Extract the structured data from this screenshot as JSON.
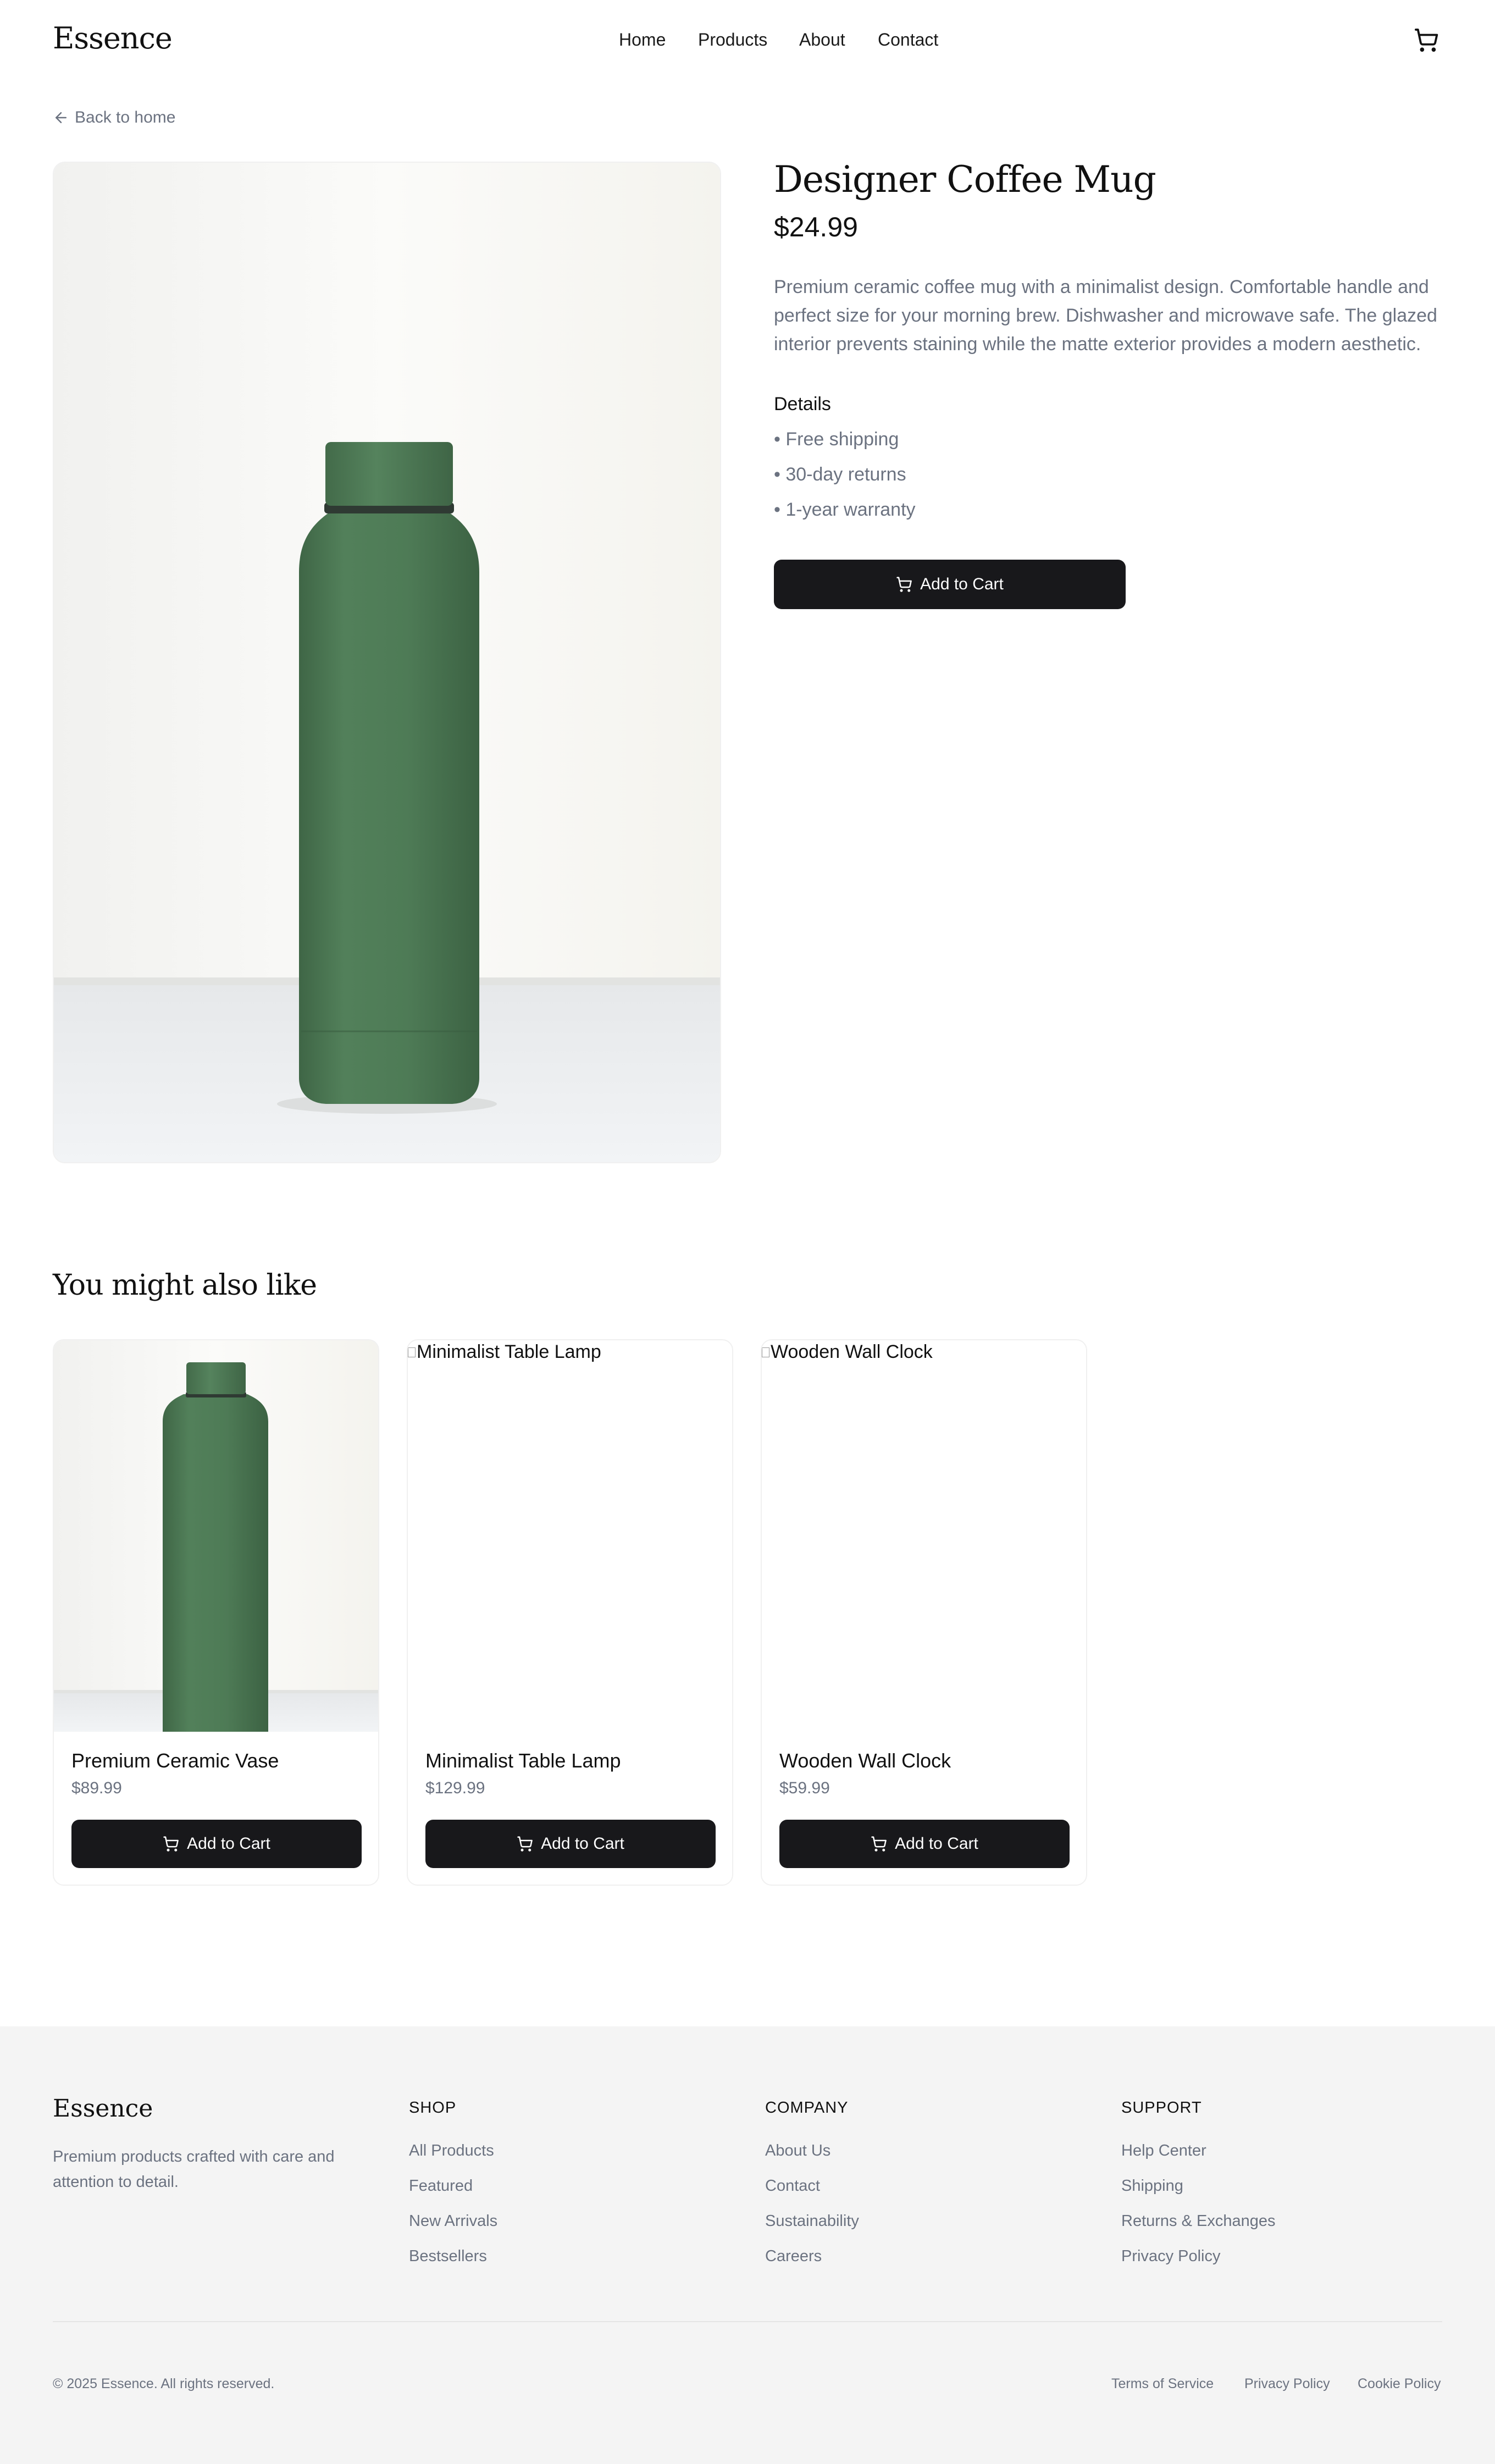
{
  "header": {
    "logo": "Essence",
    "nav": [
      "Home",
      "Products",
      "About",
      "Contact"
    ],
    "cart_icon": "cart-icon"
  },
  "back_link": "Back to home",
  "product": {
    "title": "Designer Coffee Mug",
    "price": "$24.99",
    "description": "Premium ceramic coffee mug with a minimalist design. Comfortable handle and perfect size for your morning brew. Dishwasher and microwave safe. The glazed interior prevents staining while the matte exterior provides a modern aesthetic.",
    "details_heading": "Details",
    "details": [
      "• Free shipping",
      "• 30-day returns",
      "• 1-year warranty"
    ],
    "add_to_cart": "Add to Cart"
  },
  "related": {
    "heading": "You might also like",
    "items": [
      {
        "name": "Premium Ceramic Vase",
        "price": "$89.99",
        "button": "Add to Cart",
        "alt": ""
      },
      {
        "name": "Minimalist Table Lamp",
        "price": "$129.99",
        "button": "Add to Cart",
        "alt": "Minimalist Table Lamp"
      },
      {
        "name": "Wooden Wall Clock",
        "price": "$59.99",
        "button": "Add to Cart",
        "alt": "Wooden Wall Clock"
      }
    ]
  },
  "footer": {
    "logo": "Essence",
    "tagline": "Premium products crafted with care and attention to detail.",
    "columns": [
      {
        "heading": "SHOP",
        "links": [
          "All Products",
          "Featured",
          "New Arrivals",
          "Bestsellers"
        ]
      },
      {
        "heading": "COMPANY",
        "links": [
          "About Us",
          "Contact",
          "Sustainability",
          "Careers"
        ]
      },
      {
        "heading": "SUPPORT",
        "links": [
          "Help Center",
          "Shipping",
          "Returns & Exchanges",
          "Privacy Policy"
        ]
      }
    ],
    "copyright": "© 2025 Essence. All rights reserved.",
    "legal": [
      "Terms of Service",
      "Privacy Policy",
      "Cookie Policy"
    ]
  },
  "colors": {
    "primary_button": "#18181b",
    "muted_text": "#6b7280",
    "footer_bg": "#f4f4f4",
    "bottle_green": "#4f7a55"
  }
}
